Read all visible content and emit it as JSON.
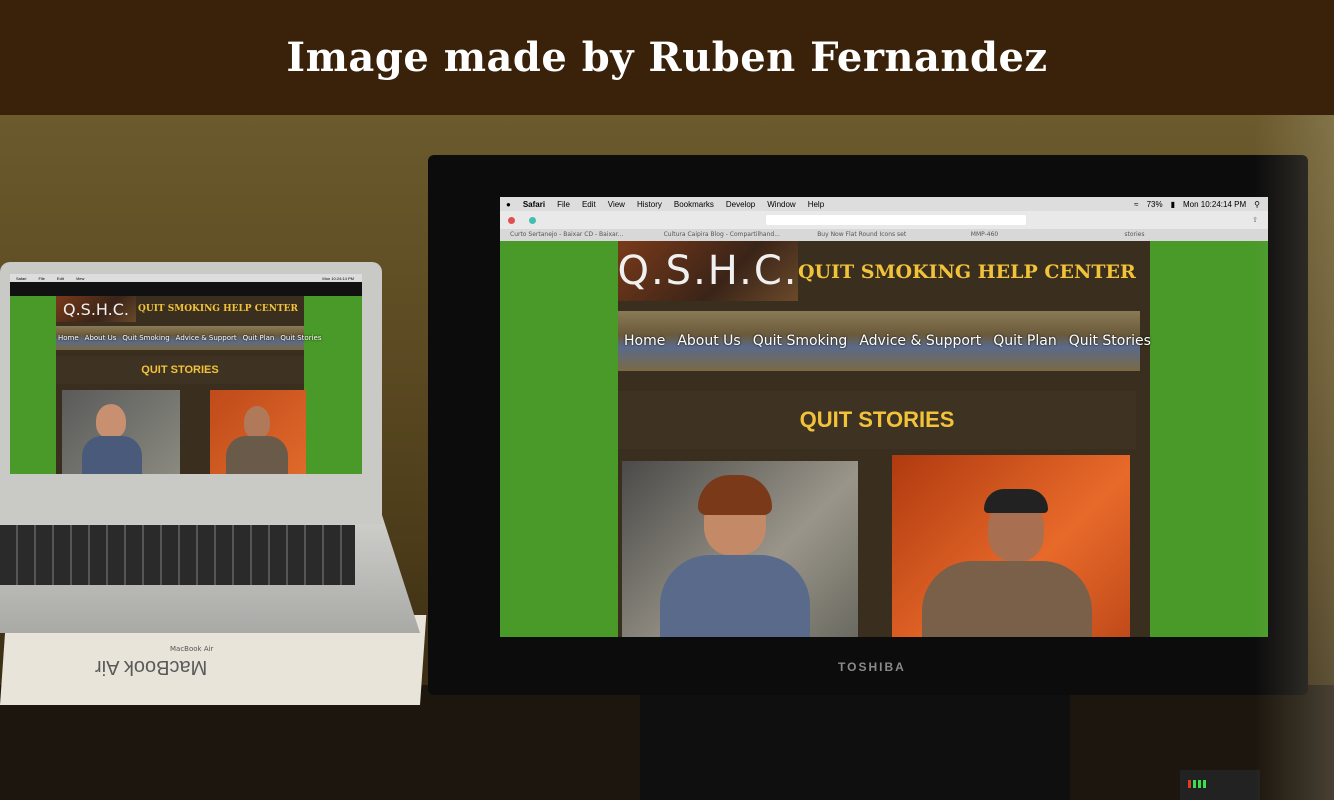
{
  "banner": {
    "title": "Image made by Ruben Fernandez"
  },
  "laptop": {
    "brand": "MacBook Air",
    "box_label": "MacBook Air"
  },
  "monitor": {
    "brand": "TOSHIBA"
  },
  "menubar": {
    "items": [
      "Safari",
      "File",
      "Edit",
      "View",
      "History",
      "Bookmarks",
      "Develop",
      "Window",
      "Help"
    ],
    "battery": "73%",
    "clock": "Mon 10:24:14 PM"
  },
  "browser": {
    "tabs": [
      "Curto Sertanejo - Baixar CD - Baixar...",
      "Cultura Caipira Blog - Compartilhand...",
      "Buy Now Flat Round Icons set",
      "MMP-460",
      "stories"
    ]
  },
  "site": {
    "logo": "Q.S.H.C.",
    "name": "QUIT SMOKING HELP CENTER",
    "nav": [
      "Home",
      "About Us",
      "Quit Smoking",
      "Advice & Support",
      "Quit Plan",
      "Quit Stories"
    ],
    "page_heading": "QUIT STORIES"
  },
  "colors": {
    "green": "#4a9a2a",
    "gold": "#f2c23a",
    "banner": "#3a220a"
  }
}
